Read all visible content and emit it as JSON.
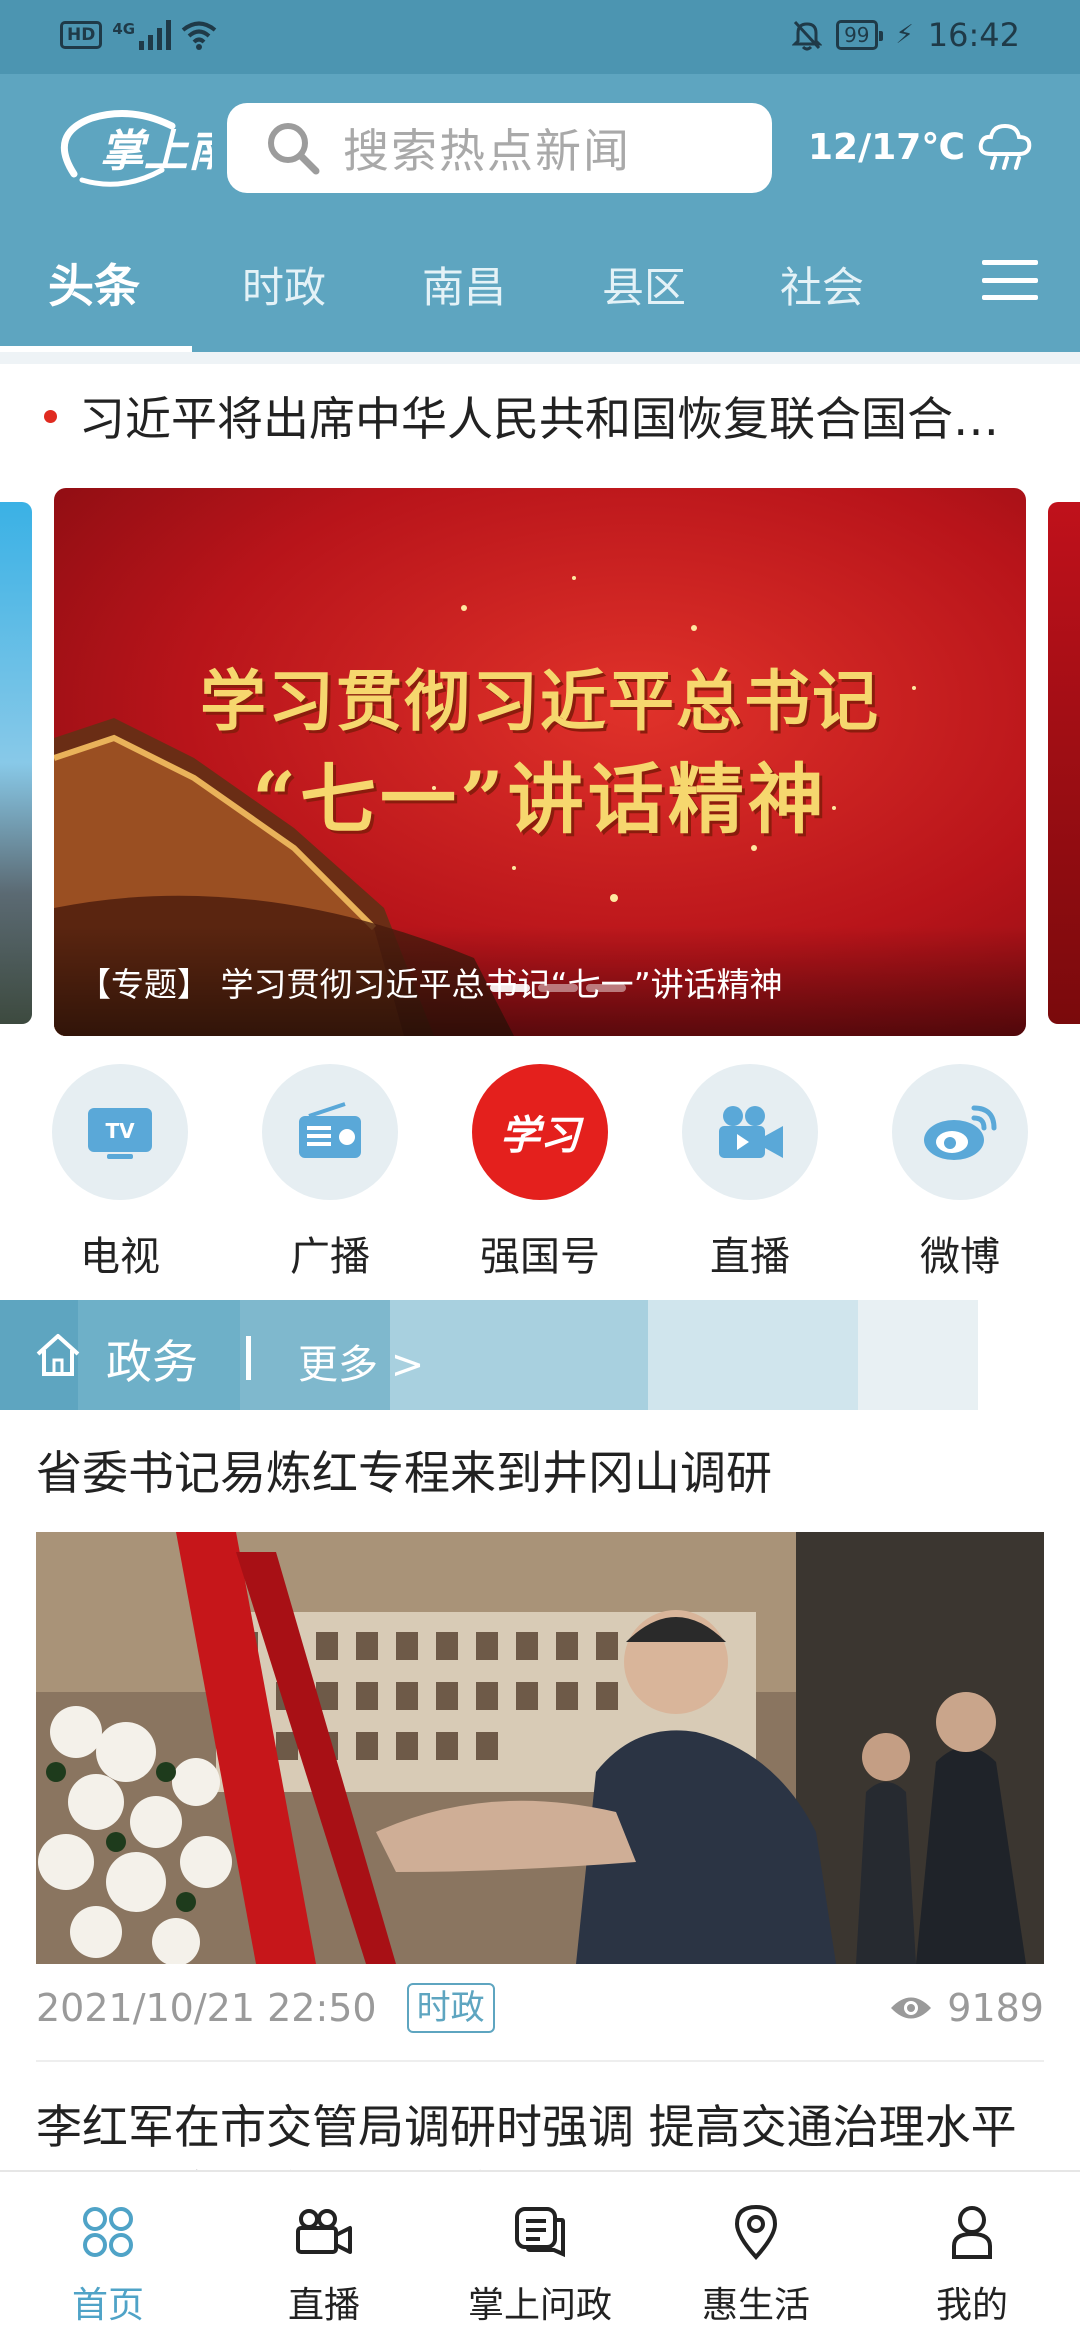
{
  "status_bar": {
    "network": "4G",
    "battery": "99",
    "time": "16:42"
  },
  "header": {
    "logo_text": "掌上南昌",
    "search_placeholder": "搜索热点新闻",
    "weather": "12/17℃"
  },
  "tabs": [
    {
      "label": "头条",
      "active": true
    },
    {
      "label": "时政",
      "active": false
    },
    {
      "label": "南昌",
      "active": false
    },
    {
      "label": "县区",
      "active": false
    },
    {
      "label": "社会",
      "active": false
    }
  ],
  "ticker": {
    "text": "习近平将出席中华人民共和国恢复联合国合…"
  },
  "banner": {
    "line1": "学习贯彻习近平总书记",
    "line2": "“七一”讲话精神",
    "caption": "【专题】 学习贯彻习近平总书记“七一”讲话精神"
  },
  "channels": [
    {
      "label": "电视",
      "icon": "tv-icon"
    },
    {
      "label": "广播",
      "icon": "radio-icon"
    },
    {
      "label": "强国号",
      "icon": "xuexi-icon",
      "badge_text": "学习"
    },
    {
      "label": "直播",
      "icon": "video-camera-icon"
    },
    {
      "label": "微博",
      "icon": "weibo-icon"
    }
  ],
  "section": {
    "title": "政务",
    "more": "更多 >"
  },
  "articles": [
    {
      "title": "省委书记易炼红专程来到井冈山调研",
      "date": "2021/10/21 22:50",
      "tag": "时政",
      "views": "9189"
    },
    {
      "title": "李红军在市交管局调研时强调 提高交通治理水平 营造安全有序通行环境"
    }
  ],
  "bottom_nav": [
    {
      "label": "首页",
      "icon": "home-grid-icon",
      "active": true
    },
    {
      "label": "直播",
      "icon": "camera-icon",
      "active": false
    },
    {
      "label": "掌上问政",
      "icon": "chat-icon",
      "active": false
    },
    {
      "label": "惠生活",
      "icon": "location-pin-icon",
      "active": false
    },
    {
      "label": "我的",
      "icon": "user-icon",
      "active": false
    }
  ],
  "colors": {
    "header_bg": "#5ea5c0",
    "status_bg": "#4c95b1",
    "accent_red": "#e02b20",
    "nav_active": "#4fa3c7"
  }
}
